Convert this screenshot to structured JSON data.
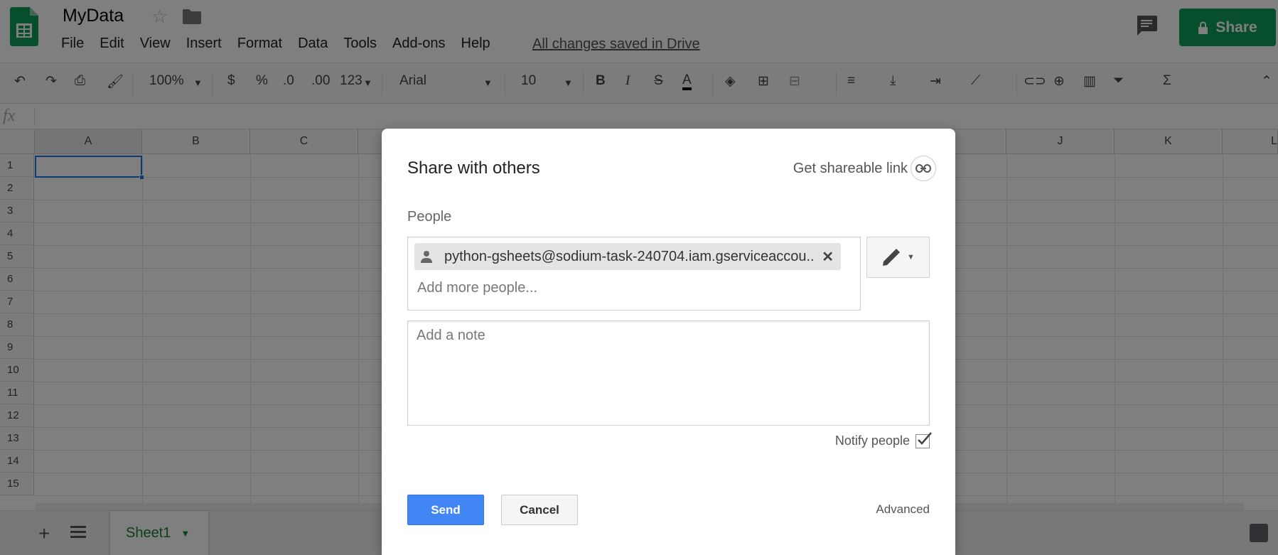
{
  "app": {
    "title": "MyData",
    "menu": [
      "File",
      "Edit",
      "View",
      "Insert",
      "Format",
      "Data",
      "Tools",
      "Add-ons",
      "Help"
    ],
    "saved_status": "All changes saved in Drive",
    "share_label": "Share",
    "accent": "#0f9d58"
  },
  "toolbar": {
    "zoom": "100%",
    "currency": "$",
    "percent": "%",
    "decimal_less": ".0",
    "decimal_more": ".00",
    "more_formats": "123",
    "font": "Arial",
    "font_size": "10"
  },
  "formula": {
    "fx": "fx"
  },
  "grid": {
    "columns": [
      "A",
      "B",
      "C",
      "J",
      "K",
      "L"
    ],
    "rows": [
      "1",
      "2",
      "3",
      "4",
      "5",
      "6",
      "7",
      "8",
      "9",
      "10",
      "11",
      "12",
      "13",
      "14",
      "15"
    ]
  },
  "sheets": {
    "active": "Sheet1"
  },
  "dialog": {
    "title": "Share with others",
    "shareable_link": "Get shareable link",
    "people_label": "People",
    "chip_email": "python-gsheets@sodium-task-240704.iam.gserviceaccou...",
    "add_people_placeholder": "Add more people...",
    "note_placeholder": "Add a note",
    "notify_label": "Notify people",
    "notify_checked": true,
    "send_label": "Send",
    "cancel_label": "Cancel",
    "advanced_label": "Advanced",
    "send_color": "#4285f4"
  }
}
